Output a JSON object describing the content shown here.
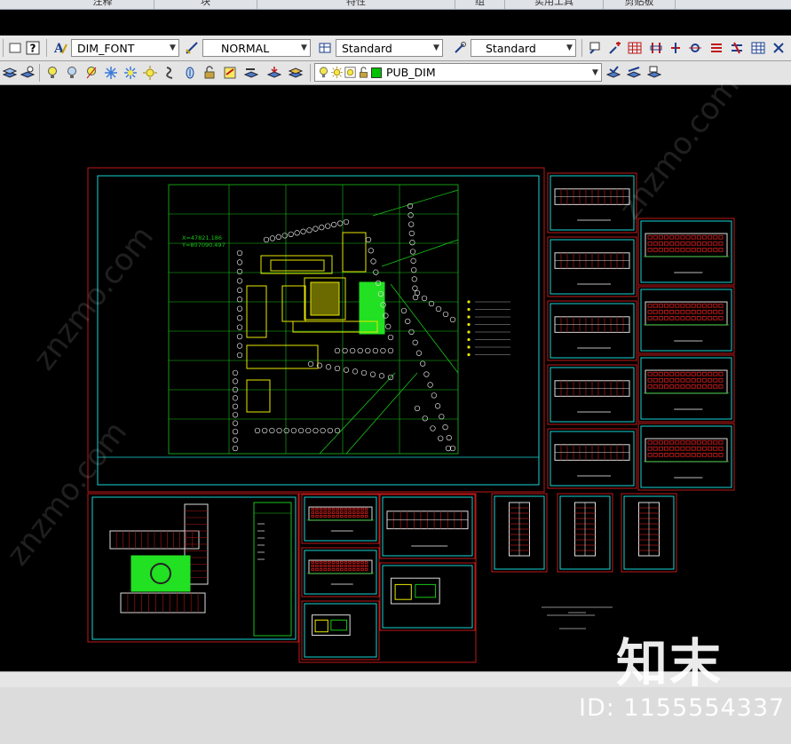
{
  "ribbon": {
    "tabs": [
      {
        "label": "注释"
      },
      {
        "label": "块"
      },
      {
        "label": "特性"
      },
      {
        "label": "组"
      },
      {
        "label": "实用工具"
      },
      {
        "label": "剪贴板"
      }
    ]
  },
  "toolbar1": {
    "help_icon": "?",
    "text_style": "DIM_FONT",
    "dim_style": "NORMAL",
    "table_style": "Standard",
    "multileader_style": "Standard"
  },
  "toolbar2": {
    "current_layer": "PUB_DIM",
    "layer_color": "#00c000"
  },
  "drawing": {
    "site_plan": {
      "coord_x": "X=47821.186",
      "coord_y": "Y=807090.497"
    }
  },
  "watermark": {
    "brand": "znzmo.com",
    "logo": "知末",
    "id_text": "ID: 1155554337"
  },
  "colors": {
    "frame_red": "#c01818",
    "frame_cyan": "#19d4d4",
    "grid_green": "#19c419",
    "building_yellow": "#e8e800",
    "fill_green": "#22e022",
    "hatch_red": "#b01818"
  }
}
